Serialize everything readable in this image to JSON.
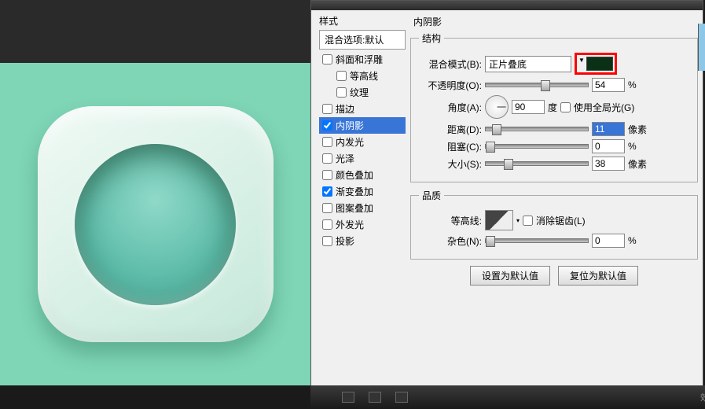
{
  "styles": {
    "header": "样式",
    "defaults": "混合选项:默认",
    "items": [
      {
        "label": "斜面和浮雕",
        "checked": false,
        "sel": false,
        "indent": false
      },
      {
        "label": "等高线",
        "checked": false,
        "sel": false,
        "indent": true
      },
      {
        "label": "纹理",
        "checked": false,
        "sel": false,
        "indent": true
      },
      {
        "label": "描边",
        "checked": false,
        "sel": false,
        "indent": false
      },
      {
        "label": "内阴影",
        "checked": true,
        "sel": true,
        "indent": false
      },
      {
        "label": "内发光",
        "checked": false,
        "sel": false,
        "indent": false
      },
      {
        "label": "光泽",
        "checked": false,
        "sel": false,
        "indent": false
      },
      {
        "label": "颜色叠加",
        "checked": false,
        "sel": false,
        "indent": false
      },
      {
        "label": "渐变叠加",
        "checked": true,
        "sel": false,
        "indent": false
      },
      {
        "label": "图案叠加",
        "checked": false,
        "sel": false,
        "indent": false
      },
      {
        "label": "外发光",
        "checked": false,
        "sel": false,
        "indent": false
      },
      {
        "label": "投影",
        "checked": false,
        "sel": false,
        "indent": false
      }
    ]
  },
  "panel": {
    "title": "内阴影",
    "structure": {
      "legend": "结构",
      "blend": {
        "label": "混合模式(B):",
        "value": "正片叠底",
        "swatch": "#0a3015"
      },
      "opacity": {
        "label": "不透明度(O):",
        "value": "54",
        "unit": "%",
        "pos": 54
      },
      "angle": {
        "label": "角度(A):",
        "value": "90",
        "unit": "度",
        "global": "使用全局光(G)",
        "globalChecked": false
      },
      "distance": {
        "label": "距离(D):",
        "value": "11",
        "unit": "像素",
        "pos": 6
      },
      "choke": {
        "label": "阻塞(C):",
        "value": "0",
        "unit": "%",
        "pos": 0
      },
      "size": {
        "label": "大小(S):",
        "value": "38",
        "unit": "像素",
        "pos": 18
      }
    },
    "quality": {
      "legend": "品质",
      "contour": {
        "label": "等高线:",
        "anti": "消除锯齿(L)",
        "antiChecked": false
      },
      "noise": {
        "label": "杂色(N):",
        "value": "0",
        "unit": "%",
        "pos": 0
      }
    },
    "buttons": {
      "setdef": "设置为默认值",
      "reset": "复位为默认值"
    }
  },
  "bottom": {
    "fx": "效果"
  }
}
